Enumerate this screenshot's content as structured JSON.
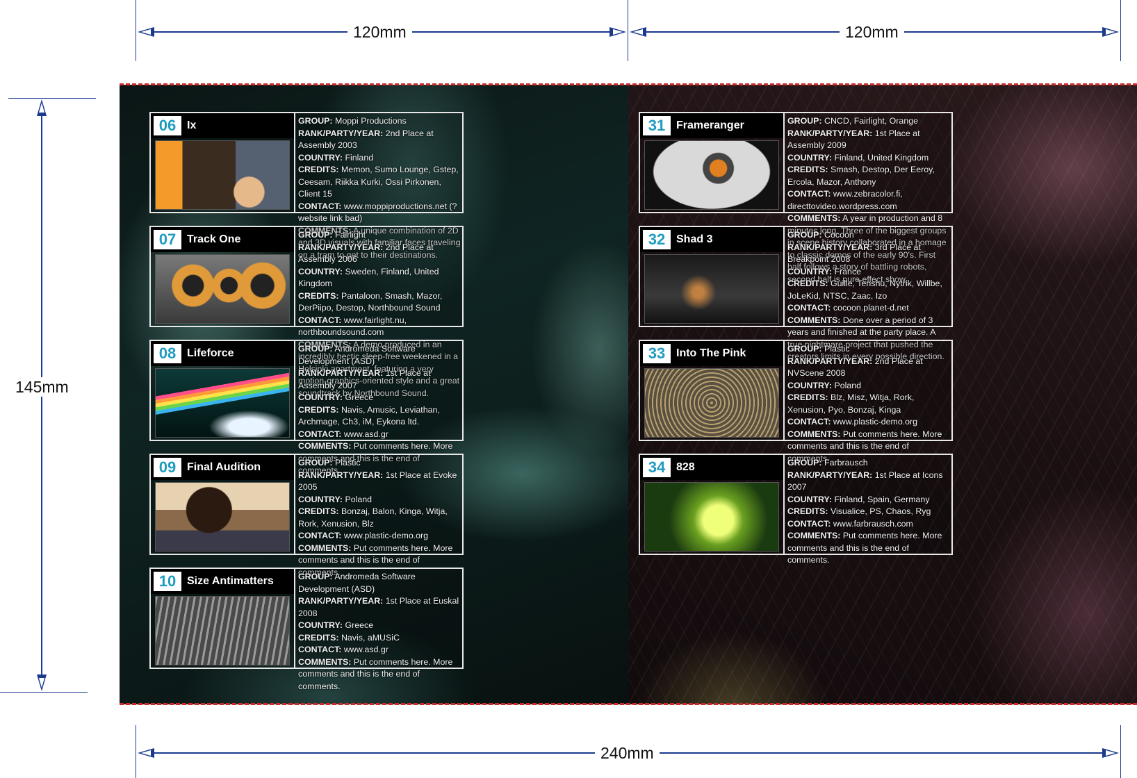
{
  "dimensions": {
    "top_left": "120mm",
    "top_right": "120mm",
    "left": "145mm",
    "bottom": "240mm"
  },
  "left_entries": [
    {
      "num": "06",
      "title": "Ix",
      "art": "art-06",
      "group": "Moppi Productions",
      "rank": "2nd Place at Assembly 2003",
      "country": "Finland",
      "credits": "Memon, Sumo Lounge, Gstep, Ceesam, Riikka Kurki, Ossi Pirkonen, Client 15",
      "contact": "www.moppiproductions.net (?website link bad)",
      "comments": "A unique combination of 2D and 3D visuals with familiar faces traveling on a tram to get to their destinations."
    },
    {
      "num": "07",
      "title": "Track One",
      "art": "art-07",
      "group": "Fairlight",
      "rank": "2nd Place at Assembly 2006",
      "country": "Sweden, Finland, United Kingdom",
      "credits": "Pantaloon, Smash, Mazor, DerPiipo, Destop, Northbound Sound",
      "contact": "www.fairlight.nu, northboundsound.com",
      "comments": "A demo produced in an incredibly hectic sleep-free weekened in a Helsinki apartment, featuring a very motion-graphics-oriented style and a great soundtrack by Northbound Sound."
    },
    {
      "num": "08",
      "title": "Lifeforce",
      "art": "art-08",
      "group": "Andromeda Software Development (ASD)",
      "rank": "1st Place at Assembly 2007",
      "country": "Greece",
      "credits": "Navis, Amusic, Leviathan, Archmage, Ch3, iM, Eykona ltd.",
      "contact": "www.asd.gr",
      "comments": "Put comments here. More comments and this is the end of comments."
    },
    {
      "num": "09",
      "title": "Final Audition",
      "art": "art-09",
      "group": "Plastic",
      "rank": "1st Place at Evoke 2005",
      "country": "Poland",
      "credits": "Bonzaj, Balon, Kinga, Witja, Rork, Xenusion, Blz",
      "contact": "www.plastic-demo.org",
      "comments": "Put comments here. More comments and this is the end of comments."
    },
    {
      "num": "10",
      "title": "Size Antimatters",
      "art": "art-10",
      "group": "Andromeda Software Development (ASD)",
      "rank": "1st Place at Euskal 2008",
      "country": "Greece",
      "credits": "Navis, aMUSiC",
      "contact": "www.asd.gr",
      "comments": "Put comments here. More comments and this is the end of comments."
    }
  ],
  "right_entries": [
    {
      "num": "31",
      "title": "Frameranger",
      "art": "art-31",
      "group": "CNCD, Fairlight, Orange",
      "rank": "1st Place at Assembly 2009",
      "country": "Finland, United Kingdom",
      "credits": "Smash, Destop, Der Eeroy, Ercola, Mazor, Anthony",
      "contact": "www.zebracolor.fi, directtovideo.wordpress.com",
      "comments": "A year in production and 8 minutes long. Three of the biggest groups in scene history collaborated in a homage to classic demos of the early 90's. First half follows a story of battling robots, second half is pure effect show."
    },
    {
      "num": "32",
      "title": "Shad 3",
      "art": "art-32",
      "group": "Cocoon",
      "rank": "3rd Place at Breakpoint 2008",
      "country": "France",
      "credits": "Guille, Tenshu, Nytrik, Willbe, JoLeKid, NTSC, Zaac, Izo",
      "contact": "cocoon.planet-d.net",
      "comments": "Done over a period of 3 years and finished at the party place. A true nightmare project that pushed the creators limits in every possible direction."
    },
    {
      "num": "33",
      "title": "Into The Pink",
      "art": "art-33",
      "group": "Plastic",
      "rank": "2nd Place at NVScene 2008",
      "country": "Poland",
      "credits": "Blz, Misz, Witja, Rork, Xenusion, Pyo, Bonzaj, Kinga",
      "contact": "www.plastic-demo.org",
      "comments": "Put comments here. More comments and this is the end of comments."
    },
    {
      "num": "34",
      "title": "828",
      "art": "art-34",
      "group": "Farbrausch",
      "rank": "1st Place at Icons 2007",
      "country": "Finland, Spain, Germany",
      "credits": "Visualice, PS, Chaos, Ryg",
      "contact": "www.farbrausch.com",
      "comments": "Put comments here. More comments and this is the end of comments."
    }
  ],
  "labels": {
    "group": "GROUP:",
    "rank": "RANK/PARTY/YEAR:",
    "country": "COUNTRY:",
    "credits": "CREDITS:",
    "contact": "CONTACT:",
    "comments": "COMMENTS:"
  }
}
